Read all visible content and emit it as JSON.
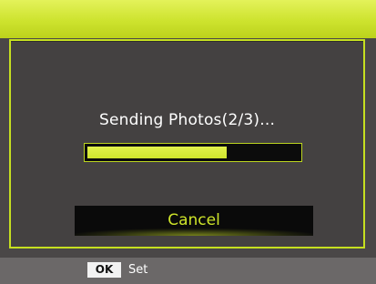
{
  "dialog": {
    "message": "Sending Photos(2/3)...",
    "progress_fraction": 0.66,
    "cancel_label": "Cancel"
  },
  "footer": {
    "ok_key": "OK",
    "ok_action": "Set"
  },
  "colors": {
    "accent": "#cde32e",
    "dialog_background": "#444141",
    "button_background": "#0a0a0a"
  }
}
